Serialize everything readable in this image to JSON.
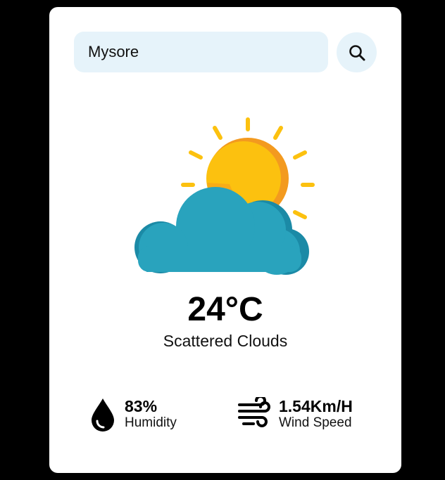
{
  "search": {
    "value": "Mysore",
    "button_icon": "search-icon"
  },
  "weather": {
    "icon": "partly-cloudy-sun-icon",
    "temperature": "24°C",
    "condition": "Scattered Clouds"
  },
  "stats": {
    "humidity": {
      "icon": "humidity-drop-icon",
      "value": "83%",
      "label": "Humidity"
    },
    "wind": {
      "icon": "wind-icon",
      "value": "1.54Km/H",
      "label": "Wind Speed"
    }
  },
  "colors": {
    "page_background": "#000000",
    "card_background": "#ffffff",
    "input_background": "#e6f3fa",
    "sun": "#fcc10f",
    "sun_shade": "#f39a1f",
    "cloud": "#29a3bd",
    "cloud_shade": "#1b8aa6"
  }
}
